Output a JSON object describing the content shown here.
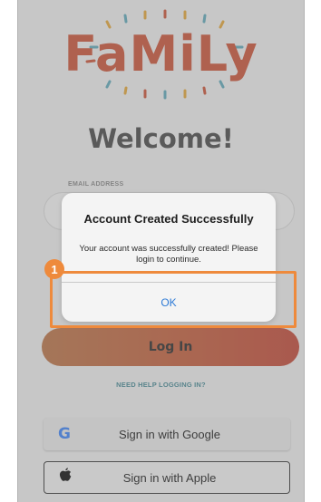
{
  "app": {
    "logo_text": "FaMiLy",
    "welcome_title": "Welcome!"
  },
  "form": {
    "email_label": "EMAIL ADDRESS",
    "email_value": "",
    "login_button": "Log In",
    "help_link": "NEED HELP LOGGING IN?"
  },
  "sso": {
    "google_label": "Sign in with Google",
    "google_icon": "google-icon",
    "google_glyph": "G",
    "apple_label": "Sign in with Apple",
    "apple_icon": "apple-icon"
  },
  "dialog": {
    "title": "Account Created Successfully",
    "message": "Your account was successfully created! Please login to continue.",
    "ok_button": "OK"
  },
  "annotation": {
    "step_number": "1",
    "highlight_color": "#ee8a3c"
  },
  "colors": {
    "brand": "#c9563b",
    "accent_link": "#4a8a95",
    "ok_button": "#2f7bd6"
  }
}
